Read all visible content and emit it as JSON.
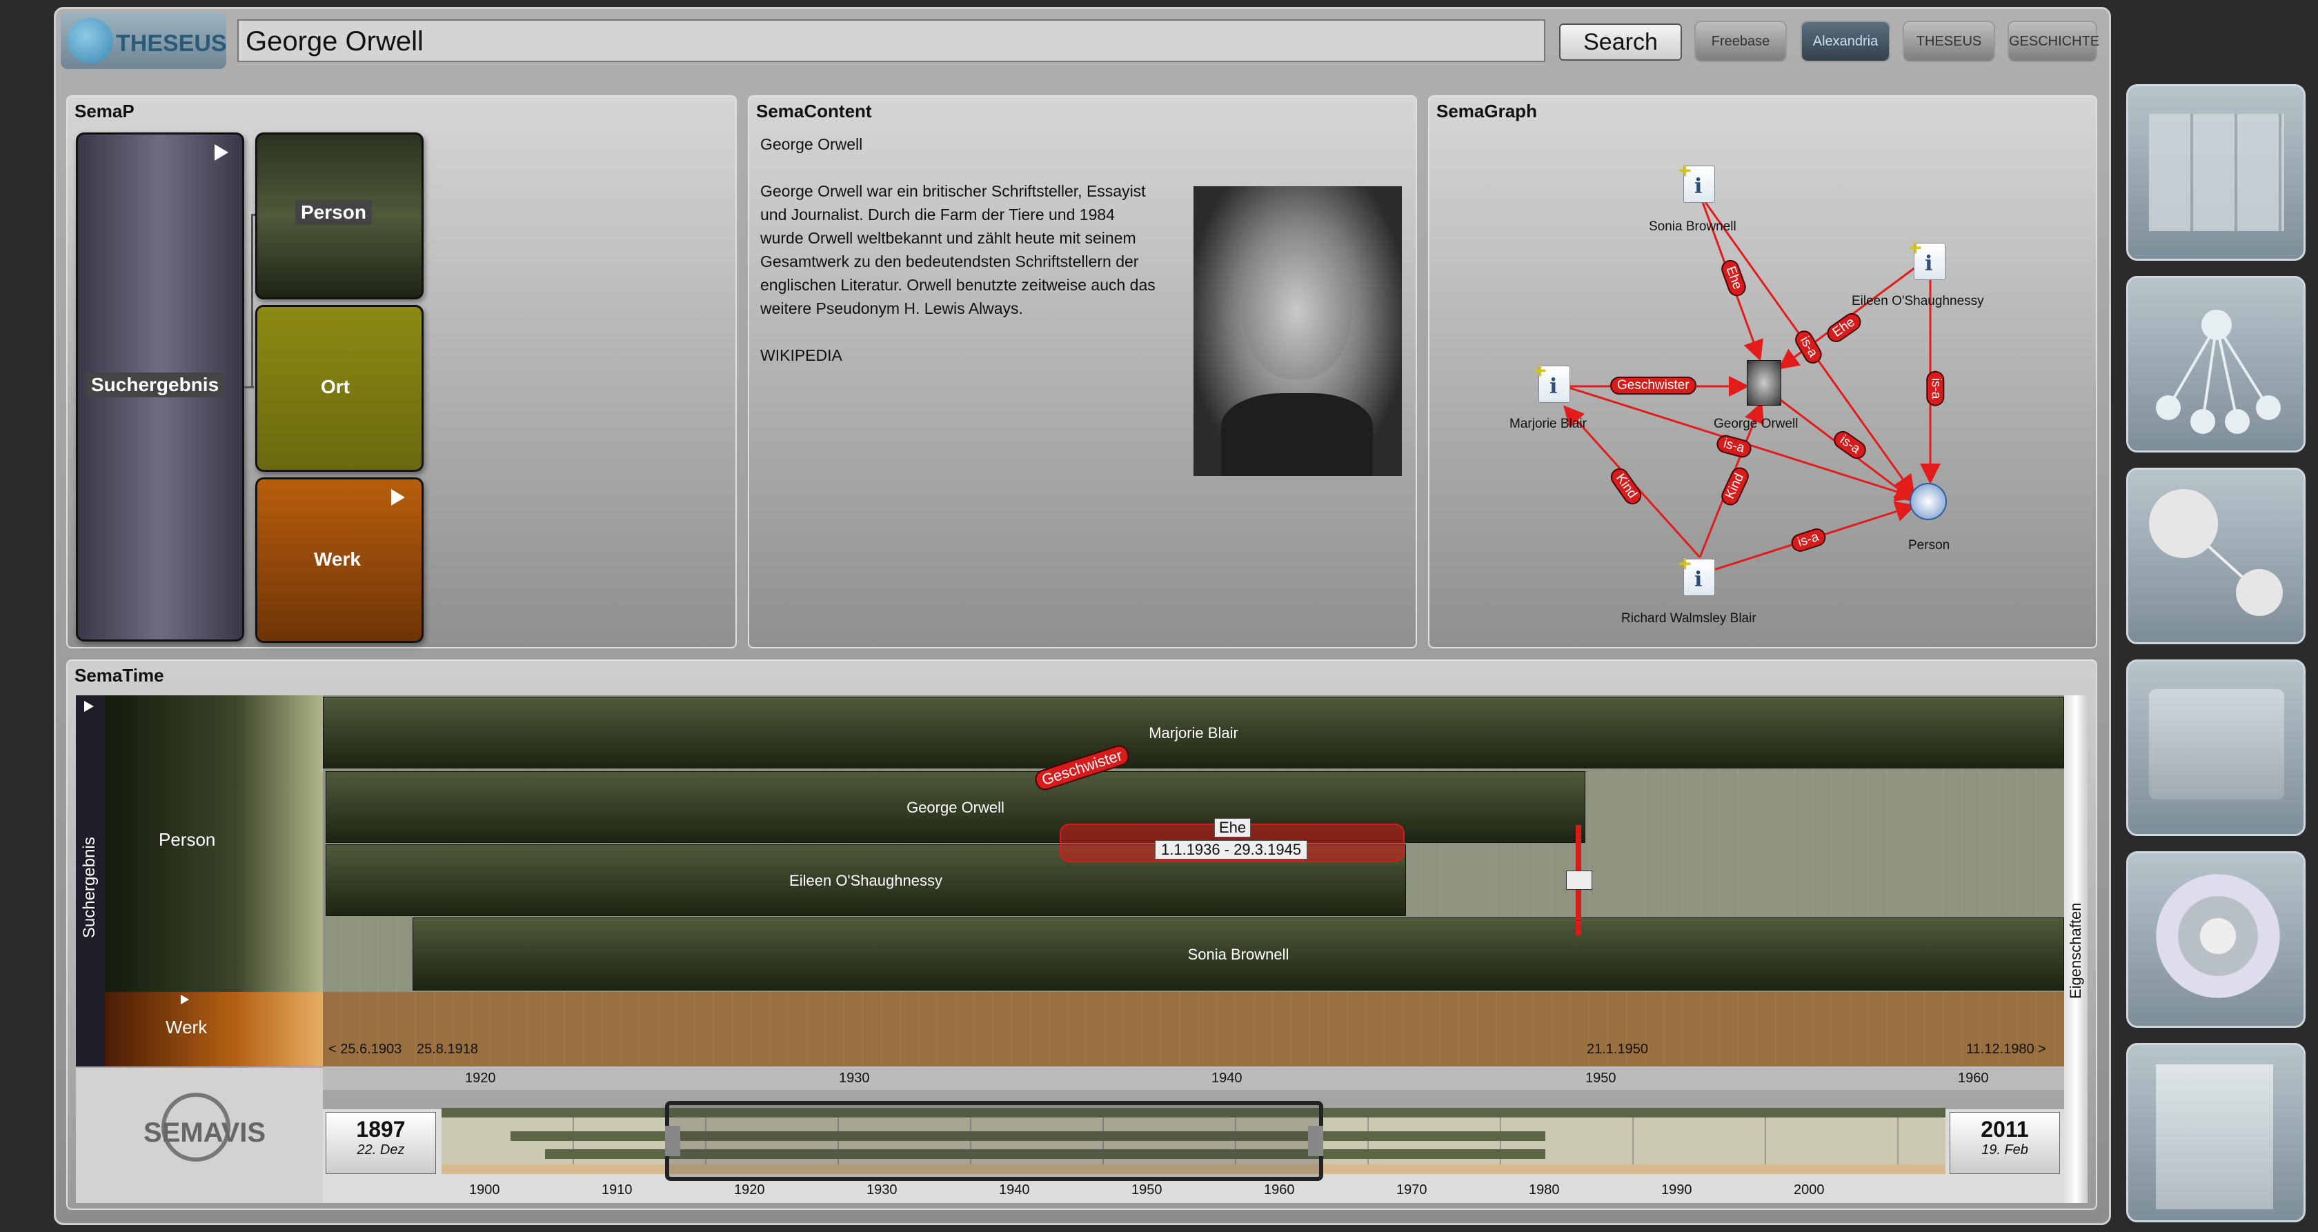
{
  "header": {
    "logo_text": "THESEUS",
    "search_value": "George Orwell",
    "search_button": "Search",
    "ext_buttons": [
      "Freebase",
      "Alexandria",
      "THESEUS",
      "GESCHICHTE"
    ]
  },
  "semap": {
    "title": "SemaP",
    "root_label": "Suchergebnis",
    "tiles": [
      "Person",
      "Ort",
      "Werk"
    ]
  },
  "semacontent": {
    "title": "SemaContent",
    "heading": "George Orwell",
    "lines": [
      "George Orwell war ein britischer Schriftsteller, Essayist",
      "und Journalist. Durch die Farm der Tiere und 1984",
      "wurde Orwell weltbekannt und zählt heute mit seinem",
      "Gesamtwerk zu den bedeutendsten Schriftstellern der",
      "englischen Literatur. Orwell benutzte zeitweise auch das",
      "weitere Pseudonym H. Lewis Always."
    ],
    "source": "WIKIPEDIA"
  },
  "semagraph": {
    "title": "SemaGraph",
    "nodes": {
      "sonia": "Sonia Brownell",
      "eileen": "Eileen O'Shaughnessy",
      "marjorie": "Marjorie Blair",
      "george": "George Orwell",
      "person": "Person",
      "richard": "Richard Walmsley Blair"
    },
    "edges": {
      "geschwister": "Geschwister",
      "ehe1": "Ehe",
      "ehe2": "Ehe",
      "isa1": "is-a",
      "isa2": "is-a",
      "isa3": "is-a",
      "isa4": "is-a",
      "isa5": "is-a",
      "kind1": "Kind",
      "kind2": "Kind"
    }
  },
  "sematime": {
    "title": "SemaTime",
    "side_label": "Suchergebnis",
    "right_label": "Eigenschaften",
    "group_person": "Person",
    "group_werk": "Werk",
    "bars": [
      "Marjorie Blair",
      "George Orwell",
      "Eileen O'Shaughnessy",
      "Sonia Brownell"
    ],
    "relation_geschwister": "Geschwister",
    "relation_ehe": "Ehe",
    "relation_ehe_dates": "1.1.1936 - 29.3.1945",
    "werk_dates": {
      "start1": "< 25.6.1903",
      "start2": "25.8.1918",
      "mid": "21.1.1950",
      "end": "11.12.1980 >"
    },
    "axis_ticks": [
      "1920",
      "1930",
      "1940",
      "1950",
      "1960"
    ],
    "overview_start_year": "1897",
    "overview_start_date": "22. Dez",
    "overview_end_year": "2011",
    "overview_end_date": "19. Feb",
    "overview_ticks": [
      "1900",
      "1910",
      "1920",
      "1930",
      "1940",
      "1950",
      "1960",
      "1970",
      "1980",
      "1990",
      "2000"
    ],
    "brand": "SEMAVIS"
  },
  "sidebar_views": [
    "treemap-view",
    "tree-view",
    "graph-view",
    "map-view",
    "sunburst-view",
    "document-view"
  ]
}
